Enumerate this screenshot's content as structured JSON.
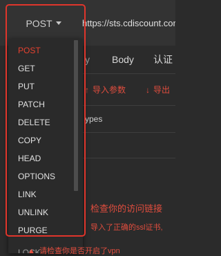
{
  "request": {
    "method": "POST",
    "url": "https://sts.cdiscount.com"
  },
  "tabs": [
    "Body",
    "认证"
  ],
  "actions": {
    "import": "导入参数",
    "export": "导出"
  },
  "types_text": "ypes",
  "dropdown": {
    "items": [
      "POST",
      "GET",
      "PUT",
      "PATCH",
      "DELETE",
      "COPY",
      "HEAD",
      "OPTIONS",
      "LINK",
      "UNLINK",
      "PURGE"
    ],
    "partial_item": "LOCK",
    "selected": "POST"
  },
  "warnings": {
    "title": "检查你的访问链接",
    "ssl": "导入了正确的ssl证书,",
    "vpn": "请检查你是否开启了vpn"
  },
  "colors": {
    "accent": "#e5412f",
    "highlight_border": "#e0352b",
    "background": "#2b2b2b"
  },
  "icons": {
    "caret": "caret-down-icon",
    "arrow_up": "arrow-up-icon",
    "arrow_down": "arrow-down-icon",
    "warning": "warning-icon"
  }
}
